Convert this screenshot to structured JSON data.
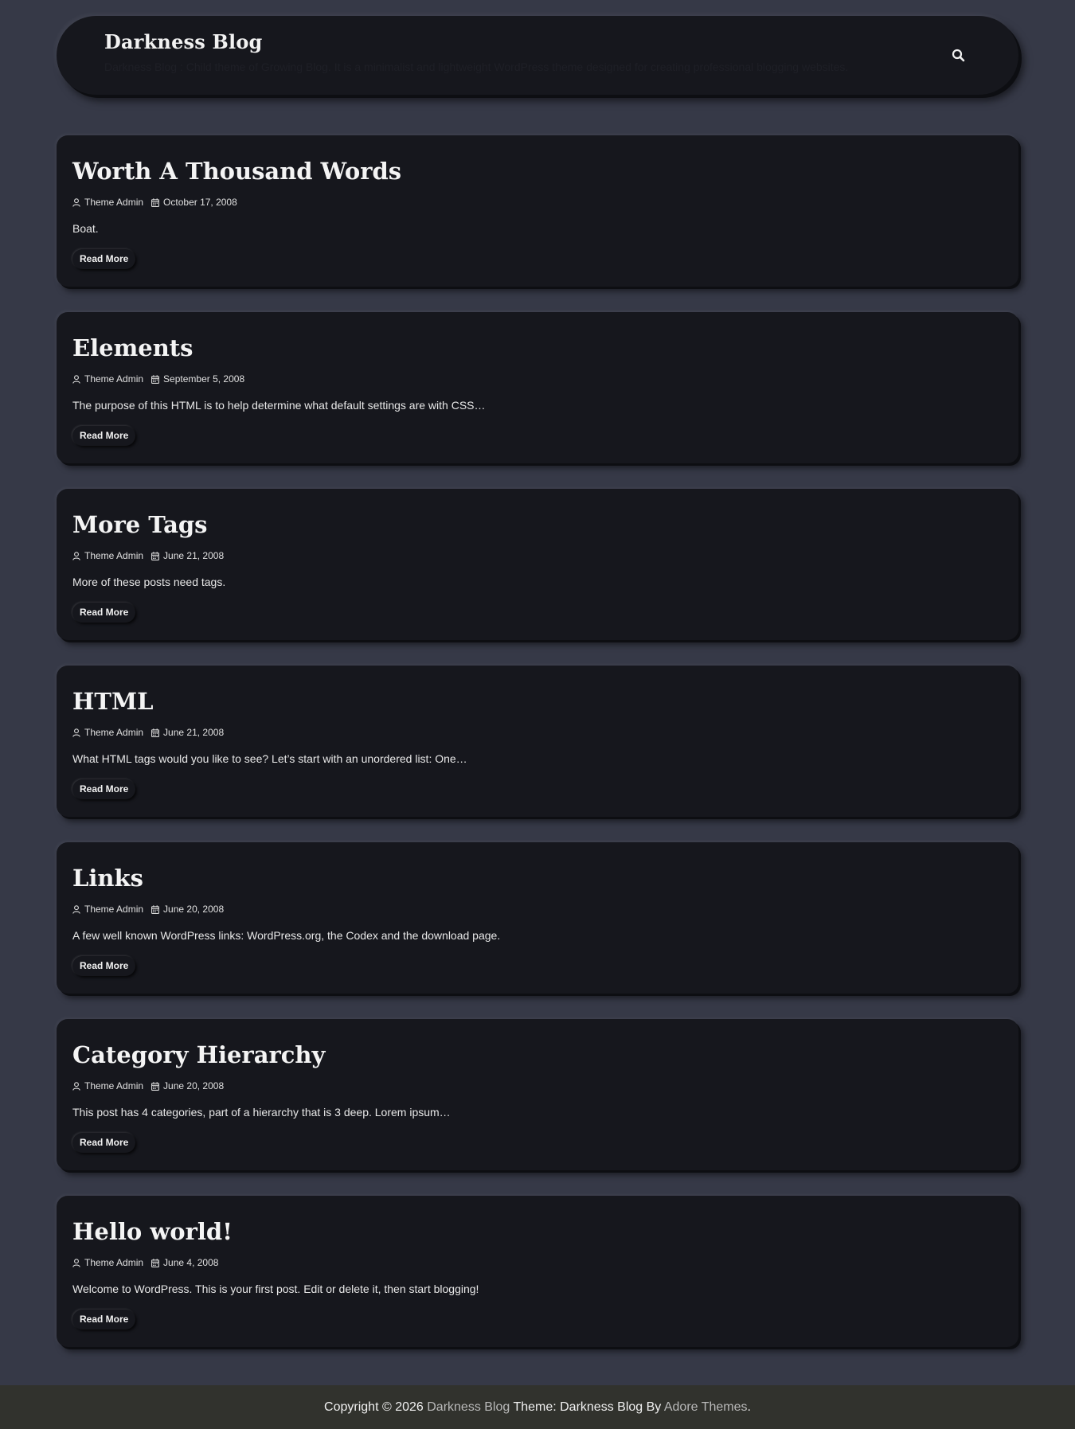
{
  "header": {
    "site_title": "Darkness Blog",
    "site_description": "Darkness Blog : Child theme of Growing Blog. It is a minimalist and lightweight WordPress theme designed for creating professional blogging websites.",
    "search_icon": "search-icon"
  },
  "posts": [
    {
      "title": "Worth A Thousand Words",
      "author": "Theme Admin",
      "date": "October 17, 2008",
      "excerpt": "Boat.",
      "read_more": "Read More"
    },
    {
      "title": "Elements",
      "author": "Theme Admin",
      "date": "September 5, 2008",
      "excerpt": "The purpose of this HTML is to help determine what default settings are with CSS…",
      "read_more": "Read More"
    },
    {
      "title": "More Tags",
      "author": "Theme Admin",
      "date": "June 21, 2008",
      "excerpt": "More of these posts need tags.",
      "read_more": "Read More"
    },
    {
      "title": "HTML",
      "author": "Theme Admin",
      "date": "June 21, 2008",
      "excerpt": "What HTML tags would you like to see? Let’s start with an unordered list: One…",
      "read_more": "Read More"
    },
    {
      "title": "Links",
      "author": "Theme Admin",
      "date": "June 20, 2008",
      "excerpt": "A few well known WordPress links: WordPress.org, the Codex and the download page.",
      "read_more": "Read More"
    },
    {
      "title": "Category Hierarchy",
      "author": "Theme Admin",
      "date": "June 20, 2008",
      "excerpt": "This post has 4 categories, part of a hierarchy that is 3 deep. Lorem ipsum…",
      "read_more": "Read More"
    },
    {
      "title": "Hello world!",
      "author": "Theme Admin",
      "date": "June 4, 2008",
      "excerpt": "Welcome to WordPress. This is your first post. Edit or delete it, then start blogging!",
      "read_more": "Read More"
    }
  ],
  "footer": {
    "copyright_prefix": "Copyright © 2026",
    "site_link": "Darkness Blog",
    "theme_text": "Theme: Darkness Blog By",
    "author_link": "Adore Themes",
    "suffix": "."
  },
  "colors": {
    "page_background": "#363947",
    "card_background": "#16171d",
    "footer_background": "#31322d",
    "link_muted": "#b9b9b9"
  }
}
